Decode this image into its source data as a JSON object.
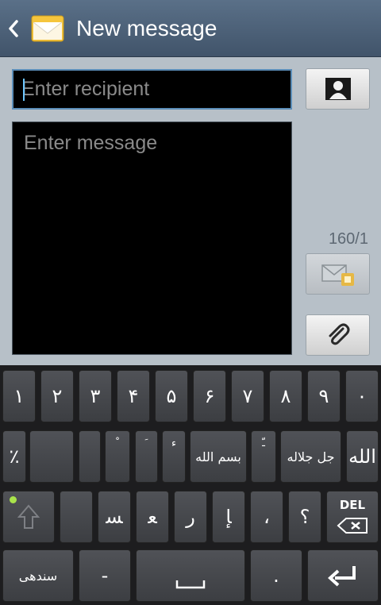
{
  "header": {
    "title": "New message"
  },
  "compose": {
    "recipient_placeholder": "Enter recipient",
    "message_placeholder": "Enter message",
    "counter": "160/1"
  },
  "keyboard": {
    "row1": [
      "١",
      "٢",
      "٣",
      "۴",
      "۵",
      "۶",
      "٧",
      "٨",
      "٩",
      "٠"
    ],
    "row2": {
      "percent": "٪",
      "k3": "ﹾ",
      "k4": "ﹶ",
      "k5": "ﺀ",
      "bismillah": "بسم الله",
      "k7": "ﹽ",
      "jalla": "جل جلاله",
      "allah": "الله"
    },
    "row3": {
      "k2": "ﺴ",
      "k3": "ﻌ",
      "k4": "ﺭ",
      "k5": "ﺈ",
      "k6": "،",
      "k7": "؟",
      "del": "DEL"
    },
    "row4": {
      "lang": "سندھی",
      "dash": "-",
      "period": "."
    }
  },
  "icons": {
    "back": "chevron-left-icon",
    "app": "envelope-icon",
    "contact": "contact-icon",
    "send": "send-mms-icon",
    "attach": "paperclip-icon",
    "shift": "shift-arrow-icon",
    "backspace": "backspace-icon",
    "space": "space-bar-icon",
    "enter": "enter-icon"
  },
  "colors": {
    "title_bar": "#4b5f75",
    "compose_bg": "#b7c0c8",
    "keyboard_bg": "#1d1d1f",
    "key_bg": "#45474b",
    "focus_border": "#5b8db8",
    "shift_indicator": "#a9e34b"
  }
}
